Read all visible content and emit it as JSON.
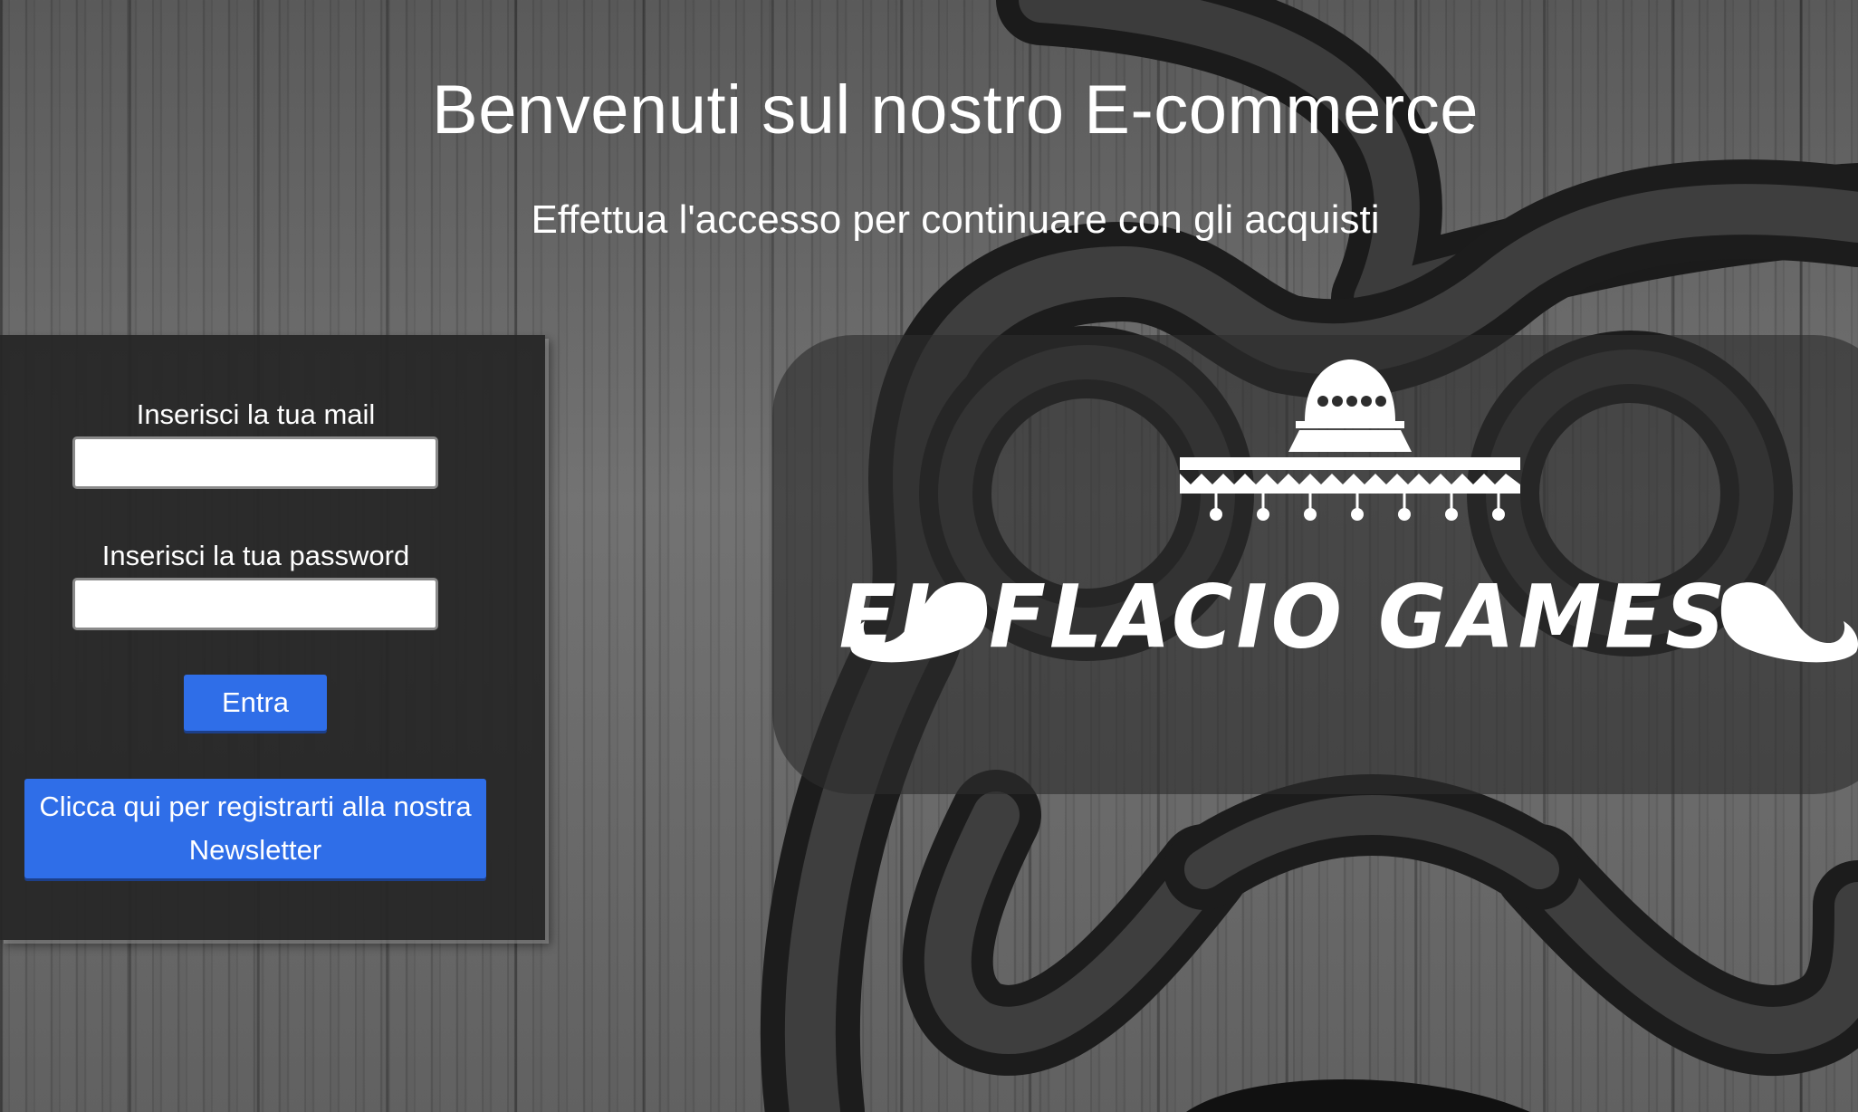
{
  "header": {
    "title": "Benvenuti sul nostro E-commerce",
    "subtitle": "Effettua l'accesso per continuare con gli acquisti"
  },
  "login_form": {
    "email_label": "Inserisci la tua mail",
    "email_value": "",
    "password_label": "Inserisci la tua password",
    "password_value": "",
    "submit_label": "Entra",
    "newsletter_label": "Clicca qui per registrarti alla nostra Newsletter"
  },
  "logo": {
    "text": "EL FLACIO GAMES",
    "icons": [
      "sombrero-icon",
      "mustache-left-icon",
      "mustache-right-icon"
    ]
  },
  "background": {
    "icon": "game-controller-icon"
  },
  "colors": {
    "accent": "#2f6ee8",
    "panel": "#262626",
    "text": "#ffffff"
  }
}
